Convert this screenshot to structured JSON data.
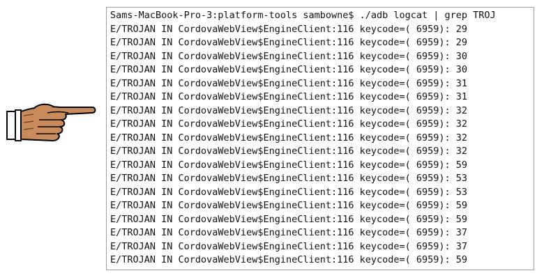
{
  "terminal": {
    "command_line": "Sams-MacBook-Pro-3:platform-tools sambowne$ ./adb logcat | grep TROJ",
    "log_lines": [
      "E/TROJAN IN CordovaWebView$EngineClient:116 keycode=( 6959): 29",
      "E/TROJAN IN CordovaWebView$EngineClient:116 keycode=( 6959): 29",
      "E/TROJAN IN CordovaWebView$EngineClient:116 keycode=( 6959): 30",
      "E/TROJAN IN CordovaWebView$EngineClient:116 keycode=( 6959): 30",
      "E/TROJAN IN CordovaWebView$EngineClient:116 keycode=( 6959): 31",
      "E/TROJAN IN CordovaWebView$EngineClient:116 keycode=( 6959): 31",
      "E/TROJAN IN CordovaWebView$EngineClient:116 keycode=( 6959): 32",
      "E/TROJAN IN CordovaWebView$EngineClient:116 keycode=( 6959): 32",
      "E/TROJAN IN CordovaWebView$EngineClient:116 keycode=( 6959): 32",
      "E/TROJAN IN CordovaWebView$EngineClient:116 keycode=( 6959): 32",
      "E/TROJAN IN CordovaWebView$EngineClient:116 keycode=( 6959): 59",
      "E/TROJAN IN CordovaWebView$EngineClient:116 keycode=( 6959): 53",
      "E/TROJAN IN CordovaWebView$EngineClient:116 keycode=( 6959): 53",
      "E/TROJAN IN CordovaWebView$EngineClient:116 keycode=( 6959): 59",
      "E/TROJAN IN CordovaWebView$EngineClient:116 keycode=( 6959): 59",
      "E/TROJAN IN CordovaWebView$EngineClient:116 keycode=( 6959): 37",
      "E/TROJAN IN CordovaWebView$EngineClient:116 keycode=( 6959): 37",
      "E/TROJAN IN CordovaWebView$EngineClient:116 keycode=( 6959): 59"
    ]
  },
  "icons": {
    "pointer": "pointing-hand-icon",
    "cursor": "block-cursor"
  },
  "colors": {
    "text": "#111111",
    "border": "#9aa0a6",
    "skin": "#c98b5c",
    "cuff": "#ffffff"
  }
}
